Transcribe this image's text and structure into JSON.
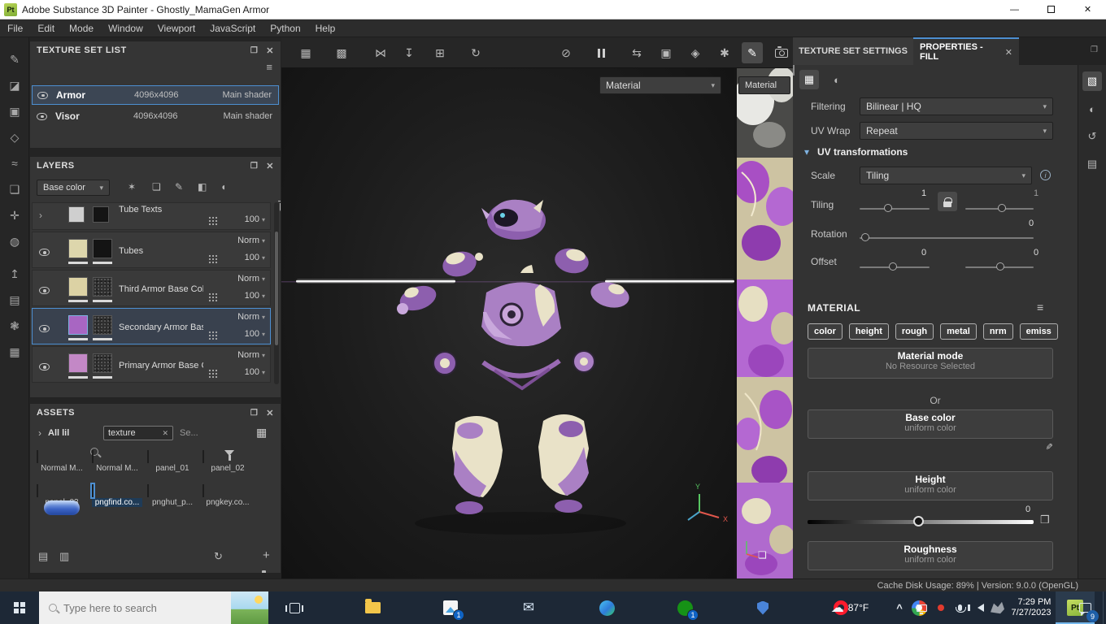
{
  "window": {
    "app_badge": "Pt",
    "title": "Adobe Substance 3D Painter - Ghostly_MamaGen Armor"
  },
  "menu": {
    "items": [
      "File",
      "Edit",
      "Mode",
      "Window",
      "Viewport",
      "JavaScript",
      "Python",
      "Help"
    ]
  },
  "icons": {
    "minimize": "—",
    "close": "✕",
    "float": "❐",
    "chevron_down": "▾",
    "chevron_right": "›",
    "chevron_up": "^",
    "hamburger": "≡",
    "grid": "▦",
    "grid_alt": "▩",
    "symmetry": "⋈",
    "drop": "↧",
    "plus_square": "⊞",
    "stopwatch": "↻",
    "eye_off": "⊘",
    "swap": "⇆",
    "cube": "▣",
    "cube_alt": "◈",
    "particles": "✱",
    "brush": "✎",
    "wand": "✶",
    "stamp": "❏",
    "pencil": "✎",
    "bucket": "◧",
    "halfmoon": "◖",
    "sliders": "▧",
    "globe": "◐",
    "history": "↺",
    "journal": "▤",
    "refresh": "↻",
    "plus": "+",
    "list": "▤",
    "list_alt": "▥",
    "grid_small": "▦",
    "info": "i",
    "expand": "❒",
    "frame": "❏",
    "left_tools": [
      "✎",
      "◪",
      "▣",
      "◇",
      "≈",
      "❏",
      "✛",
      "◍",
      "↥",
      "▤",
      "❃",
      "▦"
    ]
  },
  "texture_set_list": {
    "title": "TEXTURE SET LIST",
    "rows": [
      {
        "name": "Armor",
        "resolution": "4096x4096",
        "shader": "Main shader"
      },
      {
        "name": "Visor",
        "resolution": "4096x4096",
        "shader": "Main shader"
      }
    ]
  },
  "layers": {
    "title": "LAYERS",
    "channel_filter": "Base color",
    "rows": [
      {
        "name": "Tube Texts",
        "opacity": "100"
      },
      {
        "name": "Tubes",
        "blend": "Norm",
        "opacity": "100"
      },
      {
        "name": "Third Armor Base Color",
        "blend": "Norm",
        "opacity": "100"
      },
      {
        "name": "Secondary Armor Base ...",
        "blend": "Norm",
        "opacity": "100"
      },
      {
        "name": "Primary Armor Base Color",
        "blend": "Norm",
        "opacity": "100"
      }
    ]
  },
  "assets": {
    "title": "ASSETS",
    "scope": "All lil",
    "search_value": "texture",
    "search_hint": "Se...",
    "items": [
      "Normal M...",
      "Normal M...",
      "panel_01",
      "panel_02",
      "panel_03",
      "pngfind.co...",
      "pnghut_p...",
      "pngkey.co..."
    ]
  },
  "viewport": {
    "shader3d": "Material",
    "shader2d": "Material",
    "axis_x": "X",
    "axis_y": "Y"
  },
  "properties": {
    "tab_texture_set": "TEXTURE SET SETTINGS",
    "tab_fill": "PROPERTIES - FILL",
    "filtering_label": "Filtering",
    "filtering_value": "Bilinear | HQ",
    "uv_wrap_label": "UV Wrap",
    "uv_wrap_value": "Repeat",
    "uv_transformations": "UV transformations",
    "scale_label": "Scale",
    "scale_value": "Tiling",
    "tiling_label": "Tiling",
    "tiling_value_1": "1",
    "tiling_value_2": "1",
    "rotation_label": "Rotation",
    "rotation_value": "0",
    "offset_label": "Offset",
    "offset_value_1": "0",
    "offset_value_2": "0",
    "material_title": "MATERIAL",
    "channels": [
      "color",
      "height",
      "rough",
      "metal",
      "nrm",
      "emiss"
    ],
    "material_mode_title": "Material mode",
    "material_mode_sub": "No Resource Selected",
    "or_label": "Or",
    "base_color_title": "Base color",
    "base_color_sub": "uniform color",
    "base_color_hex": "#86489a",
    "base_color_style": "background:#86489a",
    "height_title": "Height",
    "height_sub": "uniform color",
    "height_value": "0",
    "roughness_title": "Roughness",
    "roughness_sub": "uniform color"
  },
  "status": {
    "text": "Cache Disk Usage:   89% | Version: 9.0.0 (OpenGL)"
  },
  "taskbar": {
    "search_placeholder": "Type here to search",
    "badge_calendar": "1",
    "badge_xbox": "1",
    "temperature": "87°F",
    "time": "7:29 PM",
    "date": "7/27/2023",
    "notification_count": "9",
    "app_badge": "Pt"
  }
}
